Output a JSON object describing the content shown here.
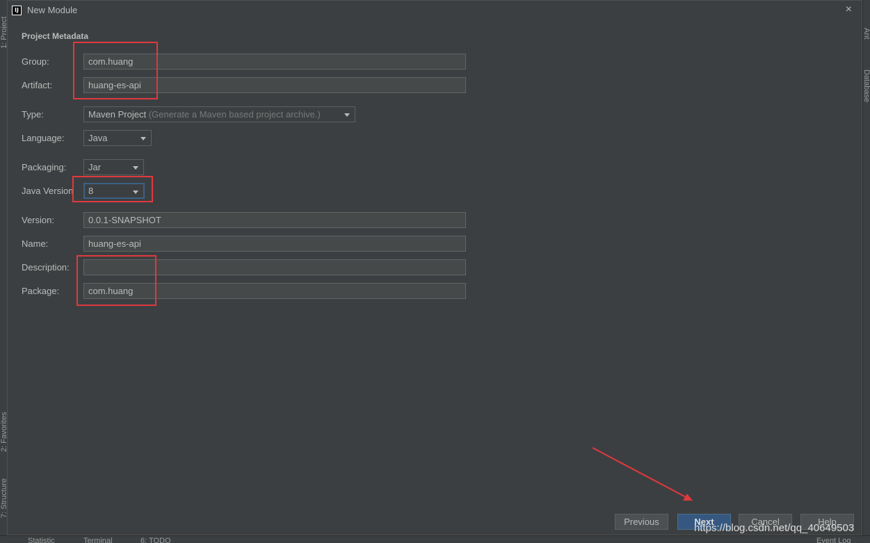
{
  "dialog": {
    "title": "New Module",
    "close_glyph": "×"
  },
  "side": {
    "left_top": "1: Project",
    "left_favorites": "2: Favorites",
    "left_structure": "7: Structure",
    "right_ant": "Ant",
    "right_database": "Database"
  },
  "bottom": {
    "statistic": "Statistic",
    "terminal": "Terminal",
    "todo": "6: TODO",
    "event_log": "Event Log"
  },
  "form": {
    "section_title": "Project Metadata",
    "group_label": "Group:",
    "group_value": "com.huang",
    "artifact_label": "Artifact:",
    "artifact_value": "huang-es-api",
    "type_label": "Type:",
    "type_value": "Maven Project",
    "type_hint": "(Generate a Maven based project archive.)",
    "language_label": "Language:",
    "language_value": "Java",
    "packaging_label": "Packaging:",
    "packaging_value": "Jar",
    "java_version_label": "Java Version",
    "java_version_value": "8",
    "version_label": "Version:",
    "version_value": "0.0.1-SNAPSHOT",
    "name_label": "Name:",
    "name_value": "huang-es-api",
    "description_label": "Description:",
    "description_value": "",
    "package_label": "Package:",
    "package_value": "com.huang"
  },
  "buttons": {
    "previous": "Previous",
    "next": "Next",
    "cancel": "Cancel",
    "help": "Help"
  },
  "watermark": "https://blog.csdn.net/qq_40649503",
  "colors": {
    "background": "#3c3f41",
    "annotation_red": "#e0393e",
    "primary_button": "#365880"
  }
}
